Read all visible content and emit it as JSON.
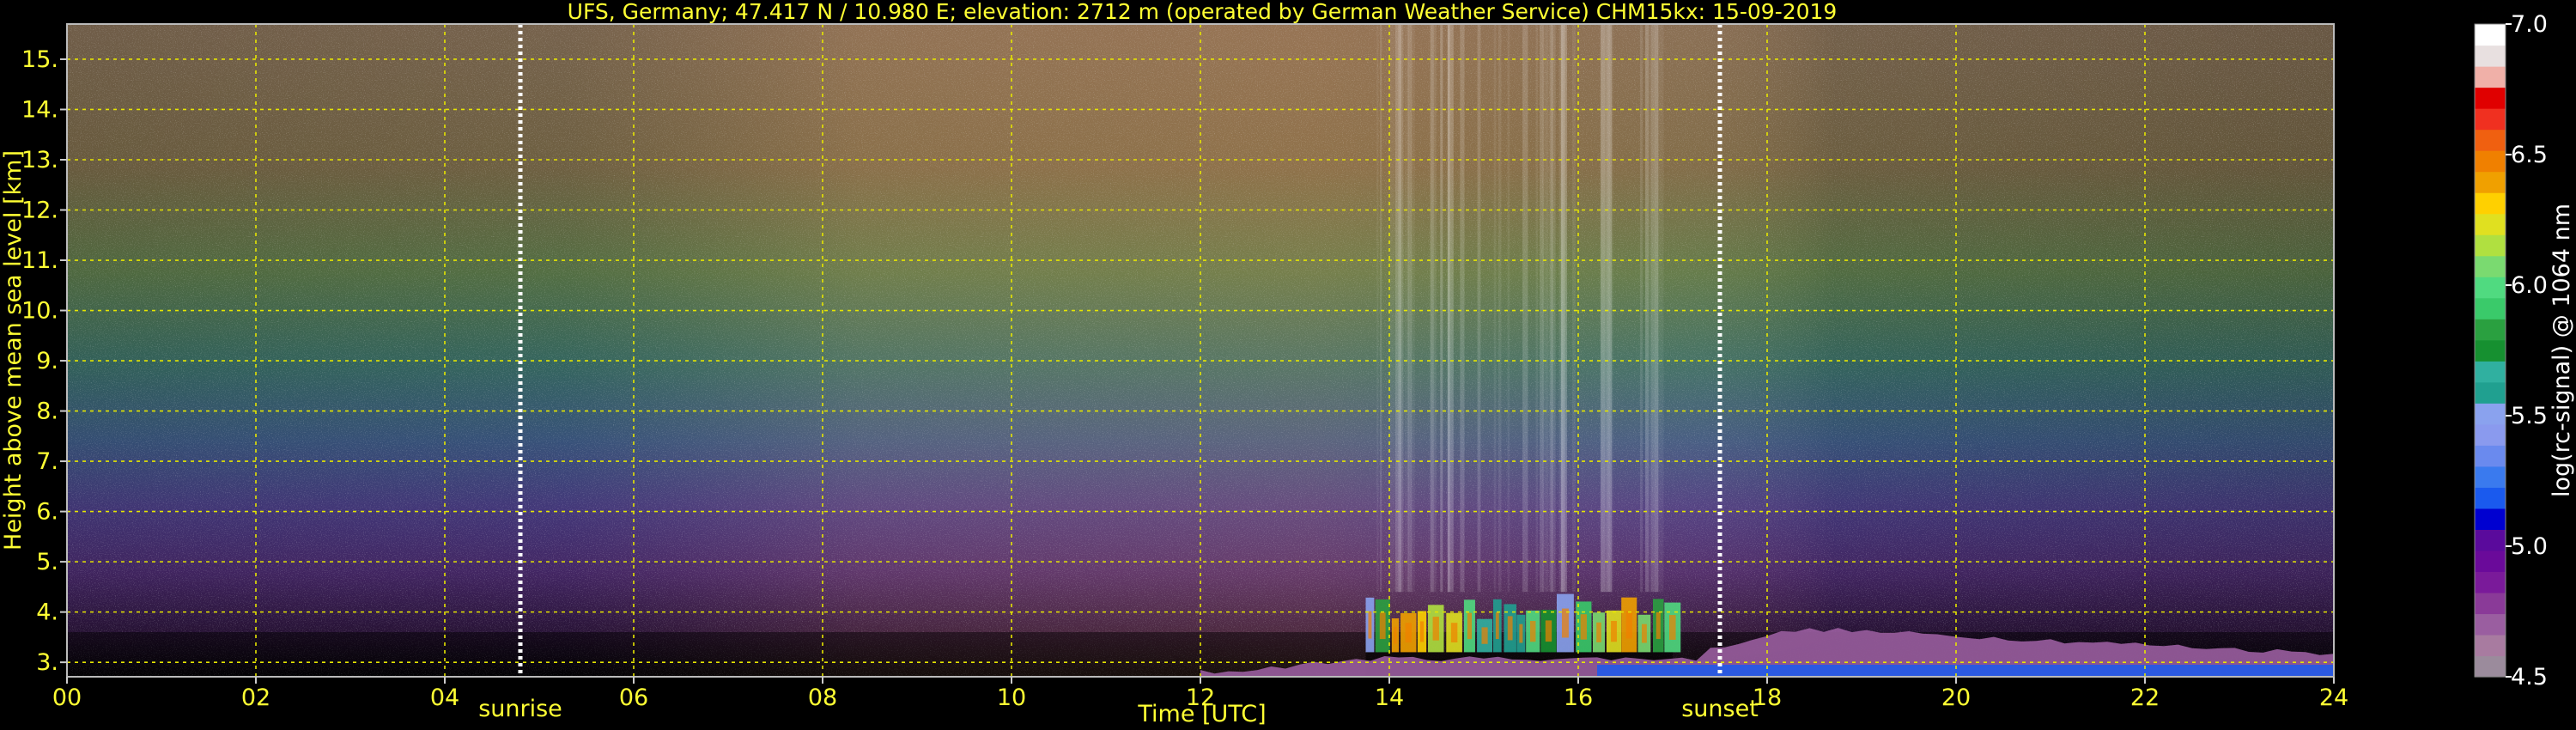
{
  "chart_data": {
    "type": "heatmap",
    "title": "UFS, Germany; 47.417 N / 10.980 E; elevation: 2712 m  (operated by German Weather Service)    CHM15kx: 15-09-2019",
    "xlabel": "Time [UTC]",
    "ylabel": "Height above mean sea level [km]",
    "xlim": [
      0,
      24
    ],
    "ylim": [
      2.712,
      15.7
    ],
    "x_ticks": [
      0,
      2,
      4,
      6,
      8,
      10,
      12,
      14,
      16,
      18,
      20,
      22,
      24
    ],
    "x_tick_labels": [
      "00",
      "02",
      "04",
      "06",
      "08",
      "10",
      "12",
      "14",
      "16",
      "18",
      "20",
      "22",
      "24"
    ],
    "y_ticks": [
      3,
      4,
      5,
      6,
      7,
      8,
      9,
      10,
      11,
      12,
      13,
      14,
      15
    ],
    "y_tick_labels": [
      "3.",
      "4.",
      "5.",
      "6.",
      "7.",
      "8.",
      "9.",
      "10.",
      "11.",
      "12.",
      "13.",
      "14.",
      "15."
    ],
    "grid": true,
    "annotations": [
      {
        "text": "sunrise",
        "x": 4.8
      },
      {
        "text": "sunset",
        "x": 17.5
      }
    ],
    "colorbar": {
      "label": "log(rc-signal) @ 1064 nm",
      "range": [
        4.5,
        7.0
      ],
      "ticks": [
        4.5,
        5.0,
        5.5,
        6.0,
        6.5,
        7.0
      ],
      "tick_labels": [
        "4.5",
        "5.0",
        "5.5",
        "6.0",
        "6.5",
        "7.0"
      ],
      "colors": [
        "#9b8b9c",
        "#a87ba0",
        "#9a5ea0",
        "#8a3a98",
        "#7a1a9a",
        "#6a0a9a",
        "#5a0a9c",
        "#0000d0",
        "#1a5aee",
        "#3a7aee",
        "#6a8aee",
        "#8a9aee",
        "#8aa2ee",
        "#20a090",
        "#30b0a0",
        "#169030",
        "#2aa040",
        "#3aca6a",
        "#50da80",
        "#7ada70",
        "#b0e040",
        "#e0e020",
        "#ffd000",
        "#f0a000",
        "#f08000",
        "#f06010",
        "#f03020",
        "#e00000",
        "#f0b0a8",
        "#e8e0e0",
        "#ffffff"
      ]
    },
    "features": [
      {
        "name": "clouds",
        "x_range": [
          13.75,
          17.0
        ],
        "height_range": [
          3.2,
          4.4
        ],
        "value_range": [
          5.5,
          6.5
        ]
      },
      {
        "name": "aerosol layer",
        "x_range": [
          12.0,
          24.0
        ],
        "height_range": [
          2.712,
          3.6
        ],
        "value_range": [
          4.6,
          5.2
        ]
      }
    ]
  }
}
